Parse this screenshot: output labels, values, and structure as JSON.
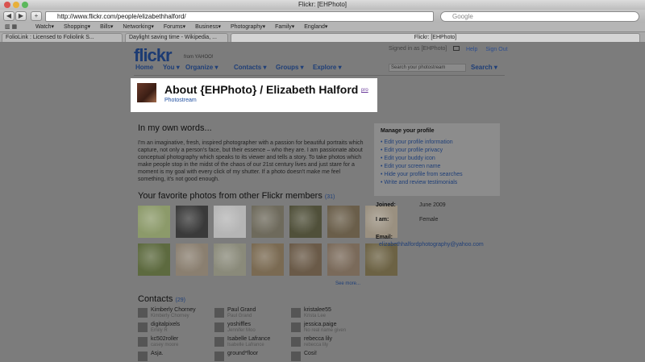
{
  "window": {
    "title": "Flickr: [EHPhoto]"
  },
  "toolbar": {
    "back": "◀",
    "forward": "▶",
    "add": "+",
    "url": "http://www.flickr.com/people/elizabethhalford/",
    "search_placeholder": "Google"
  },
  "bookmarks": [
    "Watch▾",
    "Shopping▾",
    "Bills▾",
    "Networking▾",
    "Forums▾",
    "Business▾",
    "Photography▾",
    "Family▾",
    "England▾"
  ],
  "tabs": [
    {
      "label": "FolioLink : Licensed to Foliolink S..."
    },
    {
      "label": "Daylight saving time - Wikipedia, ..."
    },
    {
      "label": "Flickr: [EHPhoto]"
    }
  ],
  "flickr": {
    "logo": "flickr",
    "from": "from YAHOO!",
    "signed_in": "Signed in as [EHPhoto]",
    "help": "Help",
    "signout": "Sign Out",
    "nav": [
      "Home",
      "You ▾",
      "Organize ▾",
      "Contacts ▾",
      "Groups ▾",
      "Explore ▾"
    ],
    "search_placeholder": "Search your photostream",
    "search_btn": "Search ▾"
  },
  "about": {
    "title": "About {EHPhoto} / Elizabeth Halford",
    "pro": "pro",
    "photostream": "Photostream"
  },
  "own_words": {
    "heading": "In my own words...",
    "text": "I'm an imaginative, fresh, inspired photographer with a passion for beautiful portraits which capture, not only a person's face, but their essence – who they are. I am passionate about conceptual photography which speaks to its viewer and tells a story. To take photos which make people stop in the midst of the chaos of our 21st century lives and just stare for a moment is my goal with every click of my shutter. If a photo doesn't make me feel something, it's not good enough."
  },
  "favorites": {
    "heading": "Your favorite photos from other Flickr members",
    "count": "(31)",
    "see_more": "See more...",
    "thumbs": [
      {
        "bg": "#8c9a6a"
      },
      {
        "bg": "#3a3a3a"
      },
      {
        "bg": "#b5b5b5"
      },
      {
        "bg": "#6e6a5c"
      },
      {
        "bg": "#50503a"
      },
      {
        "bg": "#6a5e4a"
      },
      {
        "bg": "#9a9080"
      },
      {
        "bg": "#5d6a3f"
      },
      {
        "bg": "#8a7f70"
      },
      {
        "bg": "#8a8a7a"
      },
      {
        "bg": "#7a6a52"
      },
      {
        "bg": "#6a5a48"
      },
      {
        "bg": "#7a6a5a"
      },
      {
        "bg": "#6c6244"
      }
    ]
  },
  "contacts": {
    "heading": "Contacts",
    "count": "(29)",
    "items": [
      {
        "name": "Kimberly Chorney",
        "real": "Kimberly Chorney"
      },
      {
        "name": "Paul Grand",
        "real": "Paul Grand"
      },
      {
        "name": "kristalee55",
        "real": "Krista Lee"
      },
      {
        "name": "digitalpixels",
        "real": "Emily R"
      },
      {
        "name": "yoshiffles",
        "real": "Jennifer Moo"
      },
      {
        "name": "jessica.paige",
        "real": "No real name given"
      },
      {
        "name": "kc502roller",
        "real": "casey moore"
      },
      {
        "name": "Isabelle Lafrance",
        "real": "Isabelle Lafrance"
      },
      {
        "name": "rebecca lily",
        "real": "rebecca lily"
      },
      {
        "name": "Asja.",
        "real": ""
      },
      {
        "name": "ground*floor",
        "real": ""
      },
      {
        "name": "Cosi!",
        "real": ""
      }
    ]
  },
  "manage": {
    "title": "Manage your profile",
    "links": [
      "• Edit your profile information",
      "• Edit your profile privacy",
      "• Edit your buddy icon",
      "• Edit your screen name",
      "• Hide your profile from searches",
      "• Write and review testimonials"
    ]
  },
  "info": {
    "joined_label": "Joined:",
    "joined_val": "June 2009",
    "iam_label": "I am:",
    "iam_val": "Female",
    "email_label": "Email:",
    "email_val": "elizabethhalfordphotography@yahoo.com"
  }
}
